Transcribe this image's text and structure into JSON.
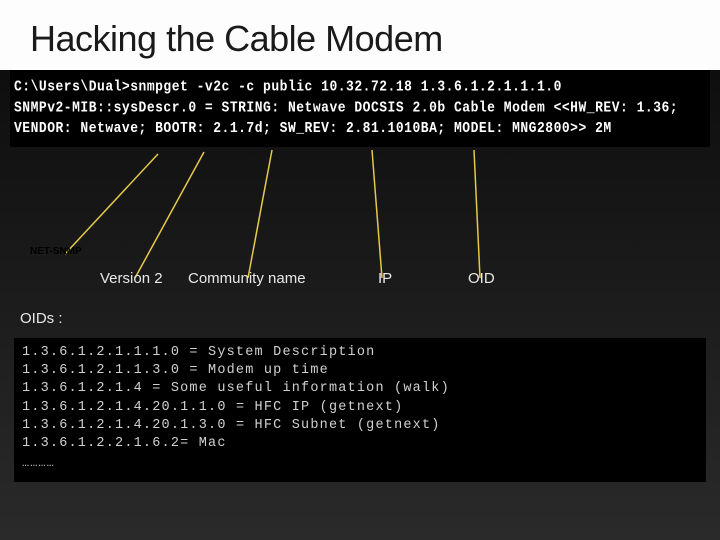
{
  "title": "Hacking the Cable Modem",
  "terminal": {
    "line1": "C:\\Users\\Dual>snmpget -v2c -c public 10.32.72.18 1.3.6.1.2.1.1.1.0",
    "line2": "SNMPv2-MIB::sysDescr.0 = STRING: Netwave DOCSIS 2.0b Cable Modem <<HW_REV: 1.36;",
    "line3": "VENDOR: Netwave; BOOTR: 2.1.7d; SW_REV: 2.81.1010BA; MODEL: MNG2800>> 2M"
  },
  "labels": {
    "netsnmp": "NET-SNMP",
    "version": "Version  2",
    "community": "Community name",
    "ip": "IP",
    "oid": "OID",
    "oids_header": "OIDs :"
  },
  "oids": [
    {
      "oid": "1.3.6.1.2.1.1.1.0",
      "desc": "System Description"
    },
    {
      "oid": "1.3.6.1.2.1.1.3.0",
      "desc": "Modem up time"
    },
    {
      "oid": "1.3.6.1.2.1.4",
      "desc": "Some useful information (walk)"
    },
    {
      "oid": "1.3.6.1.2.1.4.20.1.1.0",
      "desc": "HFC IP (getnext)"
    },
    {
      "oid": "1.3.6.1.2.1.4.20.1.3.0",
      "desc": "HFC Subnet (getnext)"
    },
    {
      "oid": "1.3.6.1.2.2.1.6.2",
      "desc": "Mac",
      "sep": "= "
    }
  ],
  "ellipsis": "…………"
}
